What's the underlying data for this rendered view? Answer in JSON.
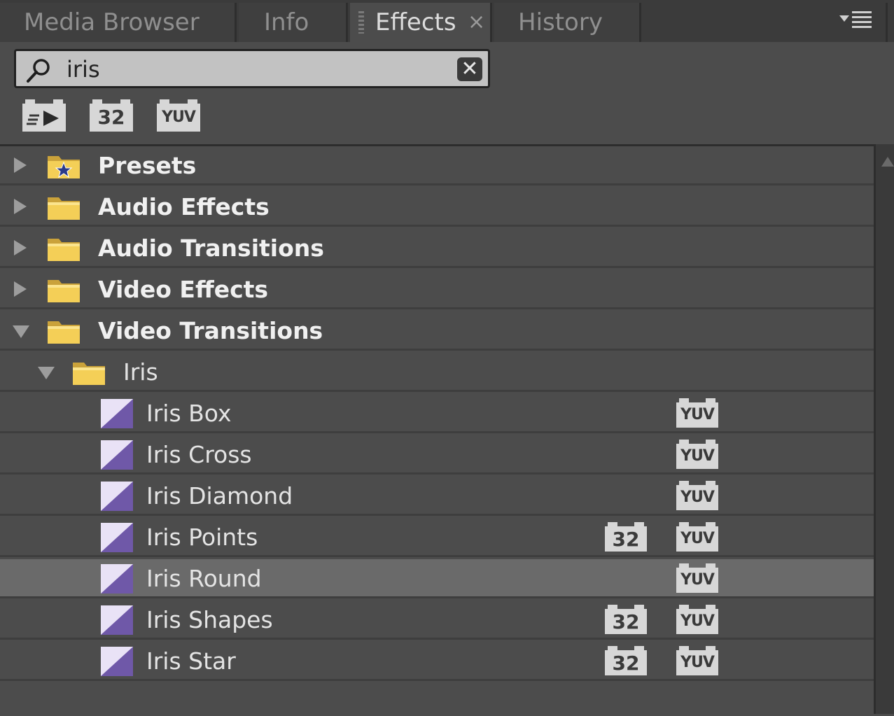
{
  "tabs": [
    {
      "label": "Media Browser"
    },
    {
      "label": "Info"
    },
    {
      "label": "Effects",
      "close": "×"
    },
    {
      "label": "History"
    }
  ],
  "search": {
    "value": "iris"
  },
  "filters": {
    "accelerated": "accelerated-effects-icon",
    "bit32_label": "32",
    "yuv_label": "YUV"
  },
  "tree": {
    "categories": [
      {
        "label": "Presets",
        "icon": "preset-folder-icon",
        "expanded": false
      },
      {
        "label": "Audio Effects",
        "icon": "folder-icon",
        "expanded": false
      },
      {
        "label": "Audio Transitions",
        "icon": "folder-icon",
        "expanded": false
      },
      {
        "label": "Video Effects",
        "icon": "folder-icon",
        "expanded": false
      },
      {
        "label": "Video Transitions",
        "icon": "folder-icon",
        "expanded": true
      }
    ],
    "subfolder": {
      "label": "Iris",
      "expanded": true
    },
    "items": [
      {
        "label": "Iris Box",
        "b32": "",
        "yuv": "YUV"
      },
      {
        "label": "Iris Cross",
        "b32": "",
        "yuv": "YUV"
      },
      {
        "label": "Iris Diamond",
        "b32": "",
        "yuv": "YUV"
      },
      {
        "label": "Iris Points",
        "b32": "32",
        "yuv": "YUV"
      },
      {
        "label": "Iris Round",
        "b32": "",
        "yuv": "YUV",
        "selected": true
      },
      {
        "label": "Iris Shapes",
        "b32": "32",
        "yuv": "YUV"
      },
      {
        "label": "Iris Star",
        "b32": "32",
        "yuv": "YUV"
      }
    ]
  },
  "colors": {
    "panel": "#4c4c4c",
    "selected_row": "#6a6a6a",
    "folder": "#f2c94c",
    "transition_icon": "#a58cd6"
  }
}
